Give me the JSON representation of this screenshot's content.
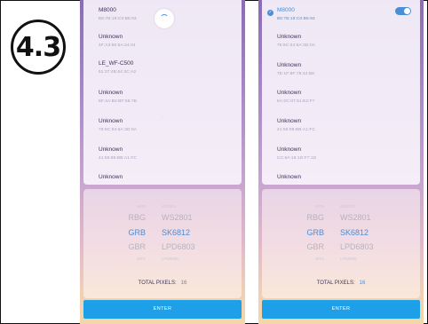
{
  "step_badge": "4.3",
  "screens": [
    {
      "devices": [
        {
          "name": "M8000",
          "mac": "B6:7B:19:C0:B5:93",
          "selected": false
        },
        {
          "name": "Unknown",
          "mac": "4F:A3:50:6A:24:04"
        },
        {
          "name": "LE_WF-C500",
          "mac": "51:37:4B:64:3C:A2"
        },
        {
          "name": "Unknown",
          "mac": "6F:4A:B3:BF:56:7B"
        },
        {
          "name": "Unknown",
          "mac": "79:9C:04:6A:3D:0A"
        },
        {
          "name": "Unknown",
          "mac": "41:55:99:BB:A1:FC"
        },
        {
          "name": "Unknown",
          "mac": ""
        }
      ],
      "picker": {
        "rows": [
          {
            "order": "RGB",
            "chip": "WS2811",
            "faint": true
          },
          {
            "order": "RBG",
            "chip": "WS2801"
          },
          {
            "order": "GRB",
            "chip": "SK6812",
            "selected": true
          },
          {
            "order": "GBR",
            "chip": "LPD6803"
          },
          {
            "order": "BRG",
            "chip": "LPD8806",
            "faint": true
          }
        ],
        "total_label": "TOTAL PIXELS:",
        "total_value": "16"
      },
      "enter_label": "ENTER"
    },
    {
      "devices": [
        {
          "name": "M8000",
          "mac": "B6:7B:19:C0:B5:93",
          "selected": true
        },
        {
          "name": "Unknown",
          "mac": "75:9C:04:6A:3D:0A"
        },
        {
          "name": "Unknown",
          "mac": "7E:1F:8F:76:44:B8"
        },
        {
          "name": "Unknown",
          "mac": "6A:0C:07:51:E2:F7"
        },
        {
          "name": "Unknown",
          "mac": "41:55:99:BB:A1:FC"
        },
        {
          "name": "Unknown",
          "mac": "CC:6A:18:1D:F7:1D"
        },
        {
          "name": "Unknown",
          "mac": ""
        }
      ],
      "picker": {
        "rows": [
          {
            "order": "RGB",
            "chip": "WS2811",
            "faint": true
          },
          {
            "order": "RBG",
            "chip": "WS2801"
          },
          {
            "order": "GRB",
            "chip": "SK6812",
            "selected": true
          },
          {
            "order": "GBR",
            "chip": "LPD6803"
          },
          {
            "order": "BRG",
            "chip": "LPD8806",
            "faint": true
          }
        ],
        "total_label": "TOTAL PIXELS:",
        "total_value": "16"
      },
      "enter_label": "ENTER"
    }
  ],
  "colors": {
    "accent": "#4a8fd6",
    "button": "#1ea0e8"
  },
  "icons": {
    "check": "check-circle-icon",
    "toggle": "toggle-switch-icon",
    "spinner": "loading-spinner-icon",
    "chevron": "chevron-down-icon"
  }
}
